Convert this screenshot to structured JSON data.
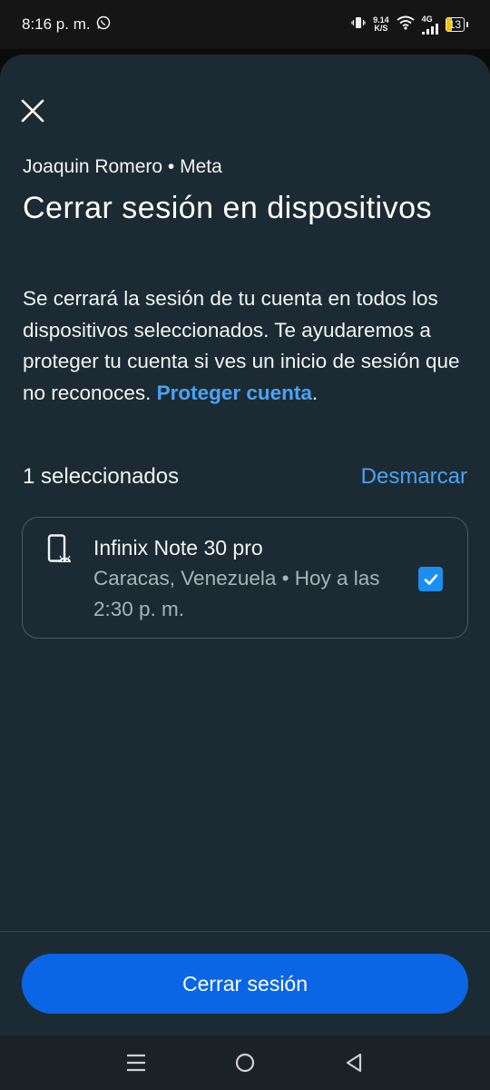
{
  "status_bar": {
    "time": "8:16 p. m.",
    "net_speed_value": "9.14",
    "net_speed_unit": "K/S",
    "network_type": "4G",
    "battery_level": "13",
    "icons": [
      "whatsapp-icon",
      "vibrate-icon",
      "wifi-icon",
      "signal-icon",
      "battery-icon"
    ]
  },
  "dialog": {
    "account_line": "Joaquin Romero • Meta",
    "title": "Cerrar sesión en dispositivos",
    "description": "Se cerrará la sesión de tu cuenta en todos los dispositivos seleccionados. Te ayudaremos a proteger tu cuenta si ves un inicio de sesión que no reconoces.",
    "protect_link": "Proteger cuenta",
    "protect_suffix": ".",
    "selected_count": "1 seleccionados",
    "unmark_label": "Desmarcar"
  },
  "devices": [
    {
      "name": "Infinix Note 30 pro",
      "meta": "Caracas, Venezuela • Hoy a las 2:30 p. m.",
      "checked": true,
      "icon": "android-phone-icon"
    }
  ],
  "primary_action": {
    "label": "Cerrar sesión"
  },
  "nav_bar": {
    "icons": [
      "menu-icon",
      "home-icon",
      "back-icon"
    ]
  },
  "colors": {
    "sheet_bg": "#1c2b33",
    "accent": "#0a66e4",
    "link": "#4aa3f5",
    "checkbox": "#1b8ef2",
    "battery_low": "#f2c200"
  }
}
